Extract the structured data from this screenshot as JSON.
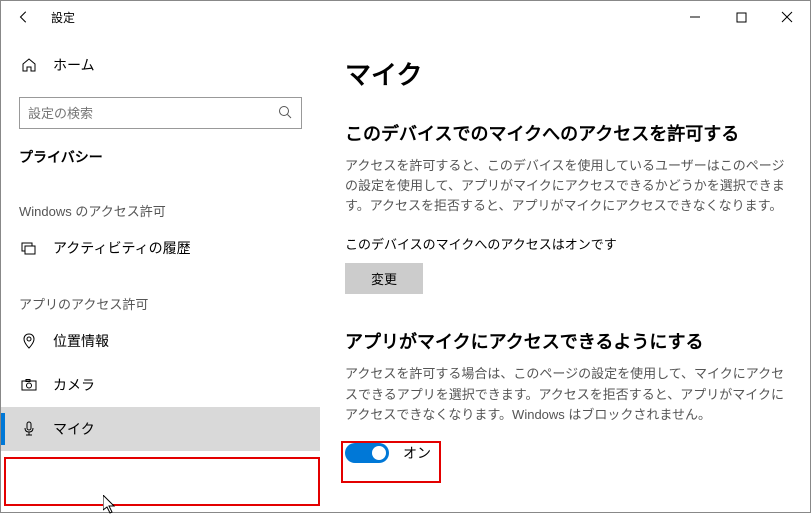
{
  "titlebar": {
    "title": "設定"
  },
  "sidebar": {
    "home": "ホーム",
    "search_placeholder": "設定の検索",
    "section_privacy": "プライバシー",
    "section_windows_perm": "Windows のアクセス許可",
    "nav_activity": "アクティビティの履歴",
    "section_app_perm": "アプリのアクセス許可",
    "nav_location": "位置情報",
    "nav_camera": "カメラ",
    "nav_mic": "マイク"
  },
  "content": {
    "page_title": "マイク",
    "h2_device": "このデバイスでのマイクへのアクセスを許可する",
    "desc_device": "アクセスを許可すると、このデバイスを使用しているユーザーはこのページの設定を使用して、アプリがマイクにアクセスできるかどうかを選択できます。アクセスを拒否すると、アプリがマイクにアクセスできなくなります。",
    "status_line": "このデバイスのマイクへのアクセスはオンです",
    "btn_change": "変更",
    "h2_app": "アプリがマイクにアクセスできるようにする",
    "desc_app": "アクセスを許可する場合は、このページの設定を使用して、マイクにアクセスできるアプリを選択できます。アクセスを拒否すると、アプリがマイクにアクセスできなくなります。Windows はブロックされません。",
    "toggle_label": "オン"
  }
}
